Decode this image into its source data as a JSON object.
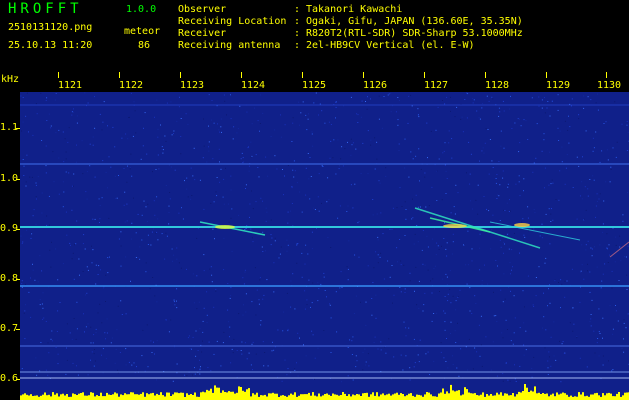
{
  "app": {
    "title": "HROFFT",
    "version": "1.0.0"
  },
  "capture": {
    "filename": "2510131120.png",
    "timestamp": "25.10.13 11:20",
    "mode_label": "meteor",
    "count": "86"
  },
  "station": {
    "separator": ":",
    "observer_key": "Observer",
    "observer_value": "Takanori Kawachi",
    "location_key": "Receiving Location",
    "location_value": "Ogaki, Gifu, JAPAN (136.60E, 35.35N)",
    "receiver_key": "Receiver",
    "receiver_value": "R820T2(RTL-SDR) SDR-Sharp 53.1000MHz",
    "antenna_key": "Receiving antenna",
    "antenna_value": "2el-HB9CV Vertical (el. E-W)"
  },
  "axes": {
    "freq_unit": "kHz",
    "minute_ticks": [
      "1121",
      "1122",
      "1123",
      "1124",
      "1125",
      "1126",
      "1127",
      "1128",
      "1129",
      "1130"
    ],
    "freq_ticks": [
      "1.1",
      "1.0",
      "0.9",
      "0.8",
      "0.7",
      "0.6"
    ]
  },
  "colors": {
    "header_green": "#00ff00",
    "text_yellow": "#ffff00",
    "background": "#000000",
    "spectrogram_blue": "#10208a"
  }
}
